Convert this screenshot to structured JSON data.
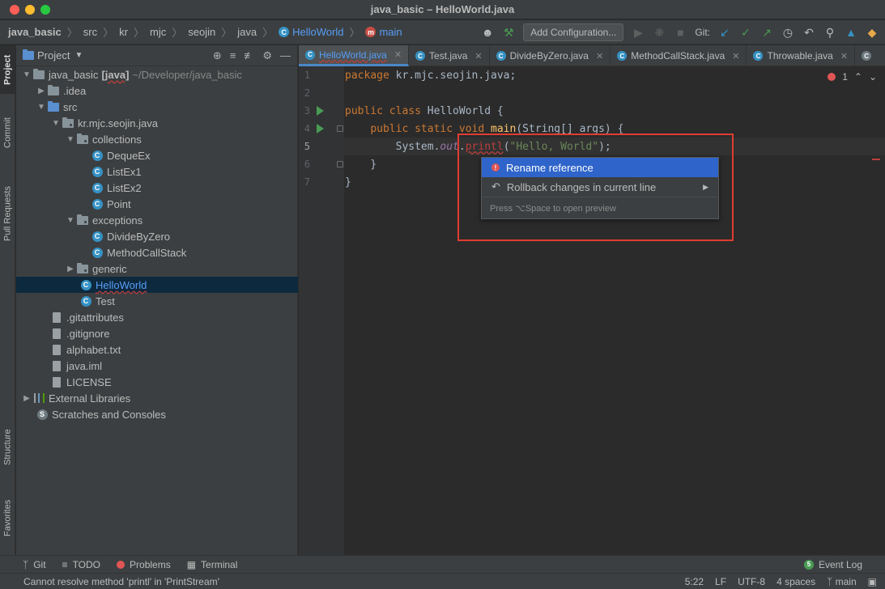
{
  "window": {
    "title": "java_basic – HelloWorld.java"
  },
  "breadcrumbs": [
    "java_basic",
    "src",
    "kr",
    "mjc",
    "seojin",
    "java",
    "HelloWorld",
    "main"
  ],
  "navbar": {
    "config_label": "Add Configuration...",
    "git_label": "Git:"
  },
  "left_tool_tabs": [
    "Project",
    "Commit",
    "Pull Requests",
    "Structure",
    "Favorites"
  ],
  "project_panel": {
    "title": "Project",
    "tree": [
      {
        "label": "java_basic",
        "extra": "[java]",
        "path": "~/Developer/java_basic"
      },
      {
        "label": ".idea"
      },
      {
        "label": "src"
      },
      {
        "label": "kr.mjc.seojin.java"
      },
      {
        "label": "collections"
      },
      {
        "label": "DequeEx"
      },
      {
        "label": "ListEx1"
      },
      {
        "label": "ListEx2"
      },
      {
        "label": "Point"
      },
      {
        "label": "exceptions"
      },
      {
        "label": "DivideByZero"
      },
      {
        "label": "MethodCallStack"
      },
      {
        "label": "generic"
      },
      {
        "label": "HelloWorld"
      },
      {
        "label": "Test"
      },
      {
        "label": ".gitattributes"
      },
      {
        "label": ".gitignore"
      },
      {
        "label": "alphabet.txt"
      },
      {
        "label": "java.iml"
      },
      {
        "label": "LICENSE"
      },
      {
        "label": "External Libraries"
      },
      {
        "label": "Scratches and Consoles"
      }
    ]
  },
  "editor_tabs": [
    "HelloWorld.java",
    "Test.java",
    "DivideByZero.java",
    "MethodCallStack.java",
    "Throwable.java"
  ],
  "editor": {
    "line_numbers": [
      "1",
      "2",
      "3",
      "4",
      "5",
      "6",
      "7"
    ],
    "code": {
      "l1_kw": "package",
      "l1_rest": " kr.mjc.seojin.java;",
      "l3_kw": "public class",
      "l3_rest": " HelloWorld {",
      "l4_indent": "    ",
      "l4_kw": "public static void",
      "l4_sp": " ",
      "l4_fn": "main",
      "l4_rest": "(String[] args) {",
      "l5_a": "        System.",
      "l5_field": "out",
      "l5_dot": ".",
      "l5_err": "printl",
      "l5_open": "(",
      "l5_str": "\"Hello, World\"",
      "l5_close": ");",
      "l6": "    }",
      "l7": "}"
    },
    "inspection_count": "1"
  },
  "intention_popup": {
    "items": [
      "Rename reference",
      "Rollback changes in current line"
    ],
    "hint": "Press ⌥Space to open preview"
  },
  "bottom_tools": {
    "git": "Git",
    "todo": "TODO",
    "problems": "Problems",
    "terminal": "Terminal",
    "event_log": "Event Log",
    "event_count": "5"
  },
  "status": {
    "message": "Cannot resolve method 'printl' in 'PrintStream'",
    "position": "5:22",
    "line_sep": "LF",
    "encoding": "UTF-8",
    "indent": "4 spaces",
    "branch": "main"
  },
  "colors": {
    "error": "#bc3f3c",
    "selection": "#2f65ca",
    "annotation_box": "#e03c31"
  }
}
